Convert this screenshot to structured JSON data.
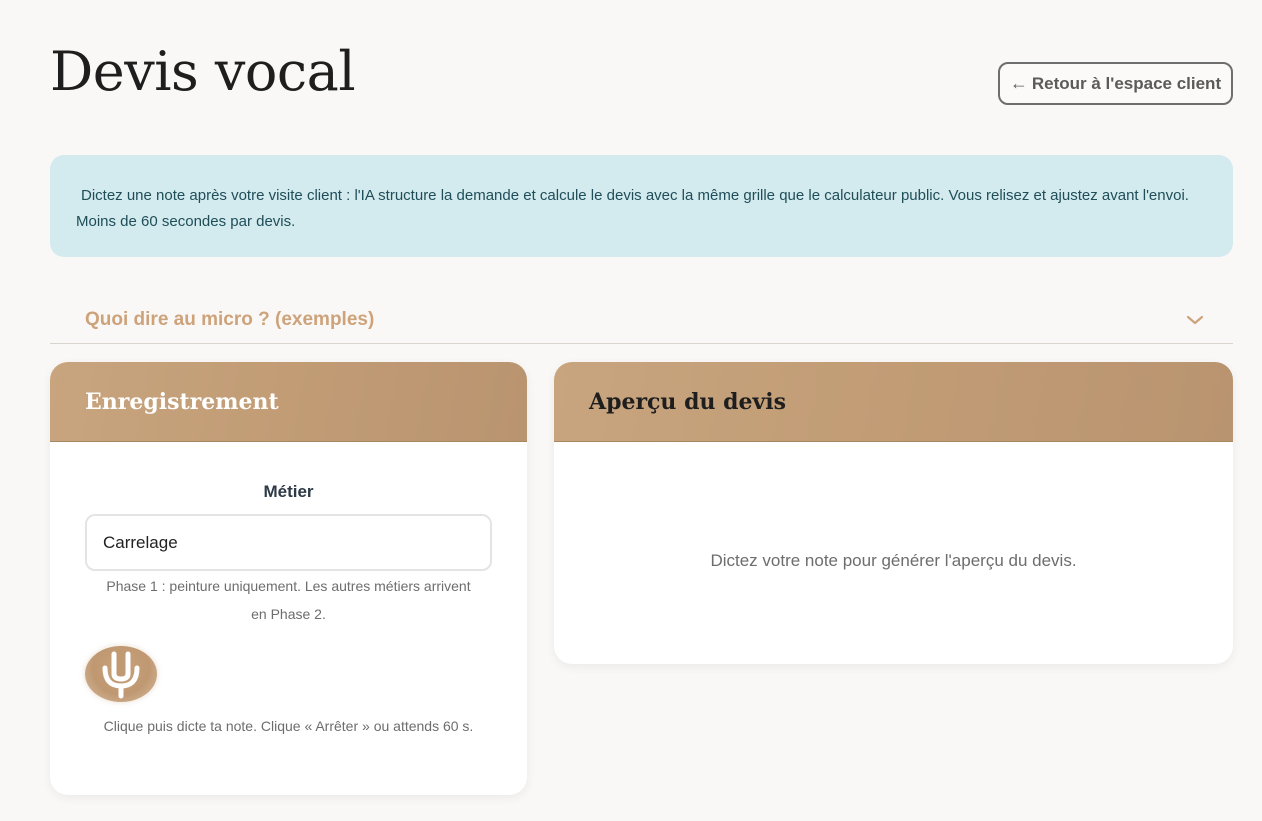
{
  "header": {
    "title": "Devis vocal",
    "back_arrow": "←",
    "back_label": "Retour à l'espace client"
  },
  "info": {
    "line1": "Dictez une note après votre visite client : l'IA structure la demande et calcule le devis avec la même grille que le calculateur public. Vous relisez et ajustez avant l'envoi.",
    "line2": "Moins de 60 secondes par devis."
  },
  "accordion": {
    "title": "Quoi dire au micro ? (exemples)",
    "icon": "chevron-down-icon"
  },
  "recording": {
    "title": "Enregistrement",
    "metier_label": "Métier",
    "metier_value": "Carrelage",
    "phase_note_line1": "Phase 1 : peinture uniquement. Les autres métiers arrivent",
    "phase_note_line2": "en Phase 2.",
    "mic_icon": "microphone-icon",
    "hint": "Clique puis dicte ta note. Clique « Arrêter » ou attends 60 s."
  },
  "preview": {
    "title": "Aperçu du devis",
    "empty_text": "Dictez votre note pour générer l'aperçu du devis."
  },
  "colors": {
    "background": "#faf8f6",
    "accent": "#c19c75",
    "accordion_text": "#cda37b",
    "banner_bg": "#d3eaee",
    "banner_text": "#1f4e58"
  }
}
